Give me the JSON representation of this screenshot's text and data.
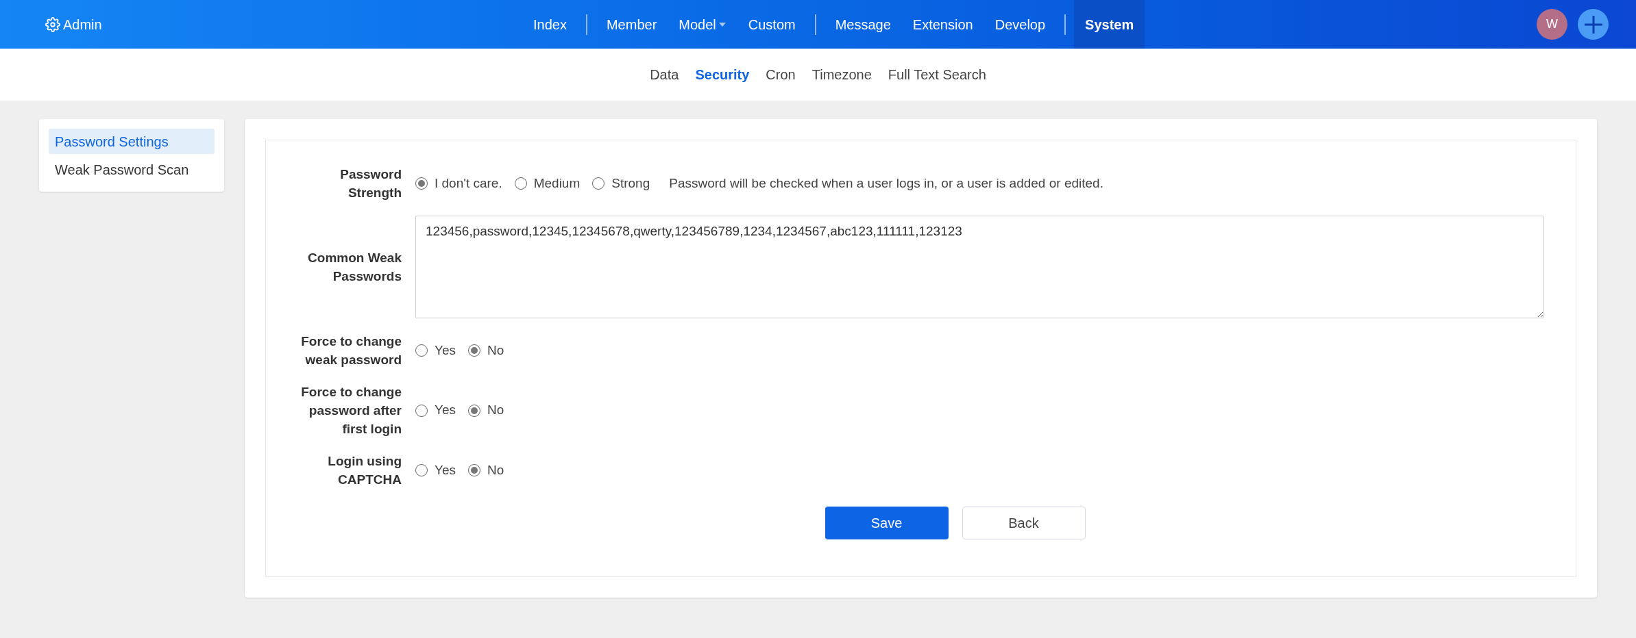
{
  "brand": {
    "label": "Admin"
  },
  "nav_groups": [
    [
      {
        "label": "Index",
        "selected": false,
        "dropdown": false
      }
    ],
    [
      {
        "label": "Member",
        "selected": false,
        "dropdown": false
      },
      {
        "label": "Model",
        "selected": false,
        "dropdown": true
      },
      {
        "label": "Custom",
        "selected": false,
        "dropdown": false
      }
    ],
    [
      {
        "label": "Message",
        "selected": false,
        "dropdown": false
      },
      {
        "label": "Extension",
        "selected": false,
        "dropdown": false
      },
      {
        "label": "Develop",
        "selected": false,
        "dropdown": false
      }
    ],
    [
      {
        "label": "System",
        "selected": true,
        "dropdown": false
      }
    ]
  ],
  "user": {
    "initial": "W"
  },
  "subnav": [
    {
      "label": "Data",
      "selected": false
    },
    {
      "label": "Security",
      "selected": true
    },
    {
      "label": "Cron",
      "selected": false
    },
    {
      "label": "Timezone",
      "selected": false
    },
    {
      "label": "Full Text Search",
      "selected": false
    }
  ],
  "sidebar": {
    "items": [
      {
        "label": "Password Settings",
        "selected": true
      },
      {
        "label": "Weak Password Scan",
        "selected": false
      }
    ]
  },
  "form": {
    "fields": [
      {
        "kind": "radio",
        "label": "Password Strength",
        "options": [
          {
            "label": "I don't care.",
            "selected": true
          },
          {
            "label": "Medium",
            "selected": false
          },
          {
            "label": "Strong",
            "selected": false
          }
        ],
        "hint": "Password will be checked when a user logs in, or a user is added or edited."
      },
      {
        "kind": "textarea",
        "label": "Common Weak Passwords",
        "value": "123456,password,12345,12345678,qwerty,123456789,1234,1234567,abc123,111111,123123"
      },
      {
        "kind": "radio",
        "label": "Force to change weak password",
        "options": [
          {
            "label": "Yes",
            "selected": false
          },
          {
            "label": "No",
            "selected": true
          }
        ]
      },
      {
        "kind": "radio",
        "label": "Force to change password after first login",
        "options": [
          {
            "label": "Yes",
            "selected": false
          },
          {
            "label": "No",
            "selected": true
          }
        ]
      },
      {
        "kind": "radio",
        "label": "Login using CAPTCHA",
        "options": [
          {
            "label": "Yes",
            "selected": false
          },
          {
            "label": "No",
            "selected": true
          }
        ]
      }
    ],
    "buttons": [
      {
        "label": "Save",
        "kind": "primary"
      },
      {
        "label": "Back",
        "kind": "secondary"
      }
    ]
  }
}
